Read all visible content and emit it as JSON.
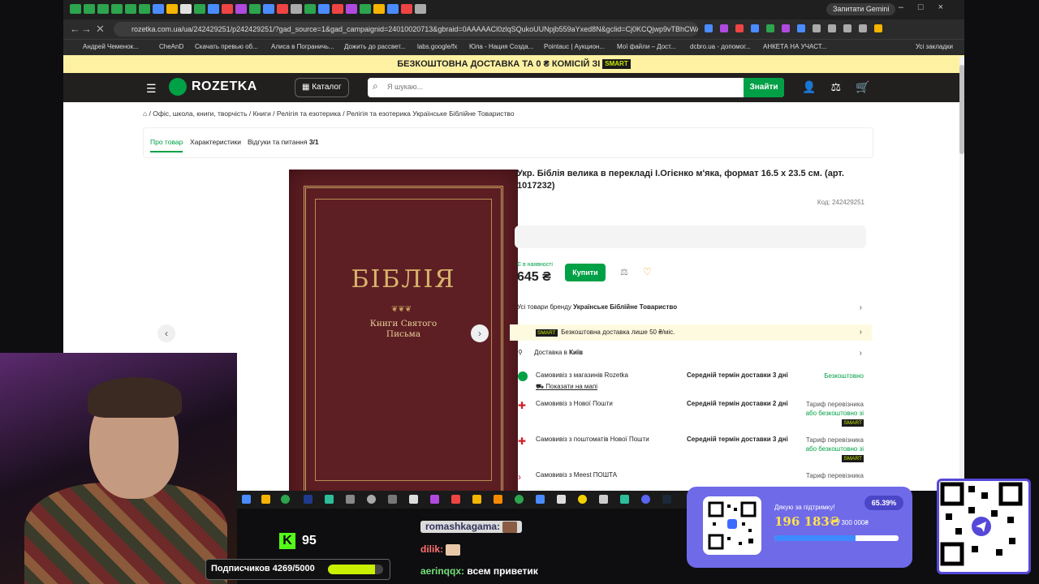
{
  "browser": {
    "url": "rozetka.com.ua/ua/242429251/p242429251/?gad_source=1&gad_campaignid=24010020713&gbraid=0AAAAACl0zlqSQukoUUNpjb559aYxed8N&gclid=Cj0KCQjwp9vTBhCWARIsANa...",
    "gemini_label": "Запитати Gemini",
    "bookmarks": [
      "Андрей Чеменок...",
      "CheAnD",
      "Скачать превью об...",
      "Алиса в Пограничь...",
      "Дожить до рассвет...",
      "labs.google/fx",
      "Юла - Нация Созда...",
      "Pointauc | Аукцион...",
      "Мої файли – Дост...",
      "dcbro.ua - допомог...",
      "АНКЕТА НА УЧАСТ...",
      "Усі закладки"
    ]
  },
  "promo": {
    "text": "БЕЗКОШТОВНА ДОСТАВКА ТА 0 ₴ КОМІСІЙ ЗІ",
    "badge": "SMART"
  },
  "header": {
    "logo": "ROZETKA",
    "catalog": "Каталог",
    "search_placeholder": "Я шукаю...",
    "find": "Знайти"
  },
  "breadcrumb": "/ Офіс, школа, книги, творчість / Книги / Релігія та езотерика / Релігія та езотерика Українське Біблійне Товариство",
  "tabs": {
    "about": "Про товар",
    "specs": "Характеристики",
    "reviews": "Відгуки та питання",
    "reviews_count": "3/1"
  },
  "book": {
    "title": "БІБЛІЯ",
    "subtitle_1": "Книги Святого",
    "subtitle_2": "Письма"
  },
  "product": {
    "title": "Укр. Біблія велика в перекладі І.Огієнко м'яка, формат 16.5 х 23.5 см. (арт. 1017232)",
    "code": "Код: 242429251",
    "stock": "Є в наявності",
    "price": "645 ₴",
    "buy": "Купити",
    "brand_prefix": "Усі товари бренду",
    "brand": "Українське Біблійне Товариство",
    "smart_badge": "SMART",
    "smart_text": "Безкоштовна доставка лише 50 ₴/міс.",
    "delivery_prefix": "Доставка в",
    "delivery_city": "Київ"
  },
  "delivery": [
    {
      "name": "Самовивіз з магазинів Rozetka",
      "extra": "Показати на мапі",
      "term": "Середній термін доставки 3 дні",
      "price": "Безкоштовно"
    },
    {
      "name": "Самовивіз з Нової Пошти",
      "term": "Середній термін доставки 2 дні",
      "price": "Тариф перевізника",
      "price2": "або безкоштовно зі",
      "badge": "SMART"
    },
    {
      "name": "Самовивіз з поштоматів Нової Пошти",
      "term": "Середній термін доставки 3 дні",
      "price": "Тариф перевізника",
      "price2": "або безкоштовно зі",
      "badge": "SMART"
    },
    {
      "name": "Самовивіз з Meest ПОШТА",
      "price": "Тариф перевізника"
    }
  ],
  "stream": {
    "kick_count": "95",
    "subs_label": "Подписчиков 4269/5000",
    "subs_progress": 0.854,
    "chat": [
      {
        "user": "romashkagama:",
        "msg": ""
      },
      {
        "user": "dilik:",
        "msg": ""
      },
      {
        "user": "aerinqqx:",
        "msg": "всем приветик"
      }
    ],
    "donate": {
      "thanks": "Дякую за підтримку!",
      "percent": "65.39%",
      "amount": "196 183₴",
      "goal": "/ 300 000₴",
      "progress": 0.6539
    }
  },
  "colors": {
    "accent": "#00a046",
    "promo_bg": "#fef1a2",
    "header_bg": "#221f1f",
    "donate_bg": "#6f6ae8"
  }
}
